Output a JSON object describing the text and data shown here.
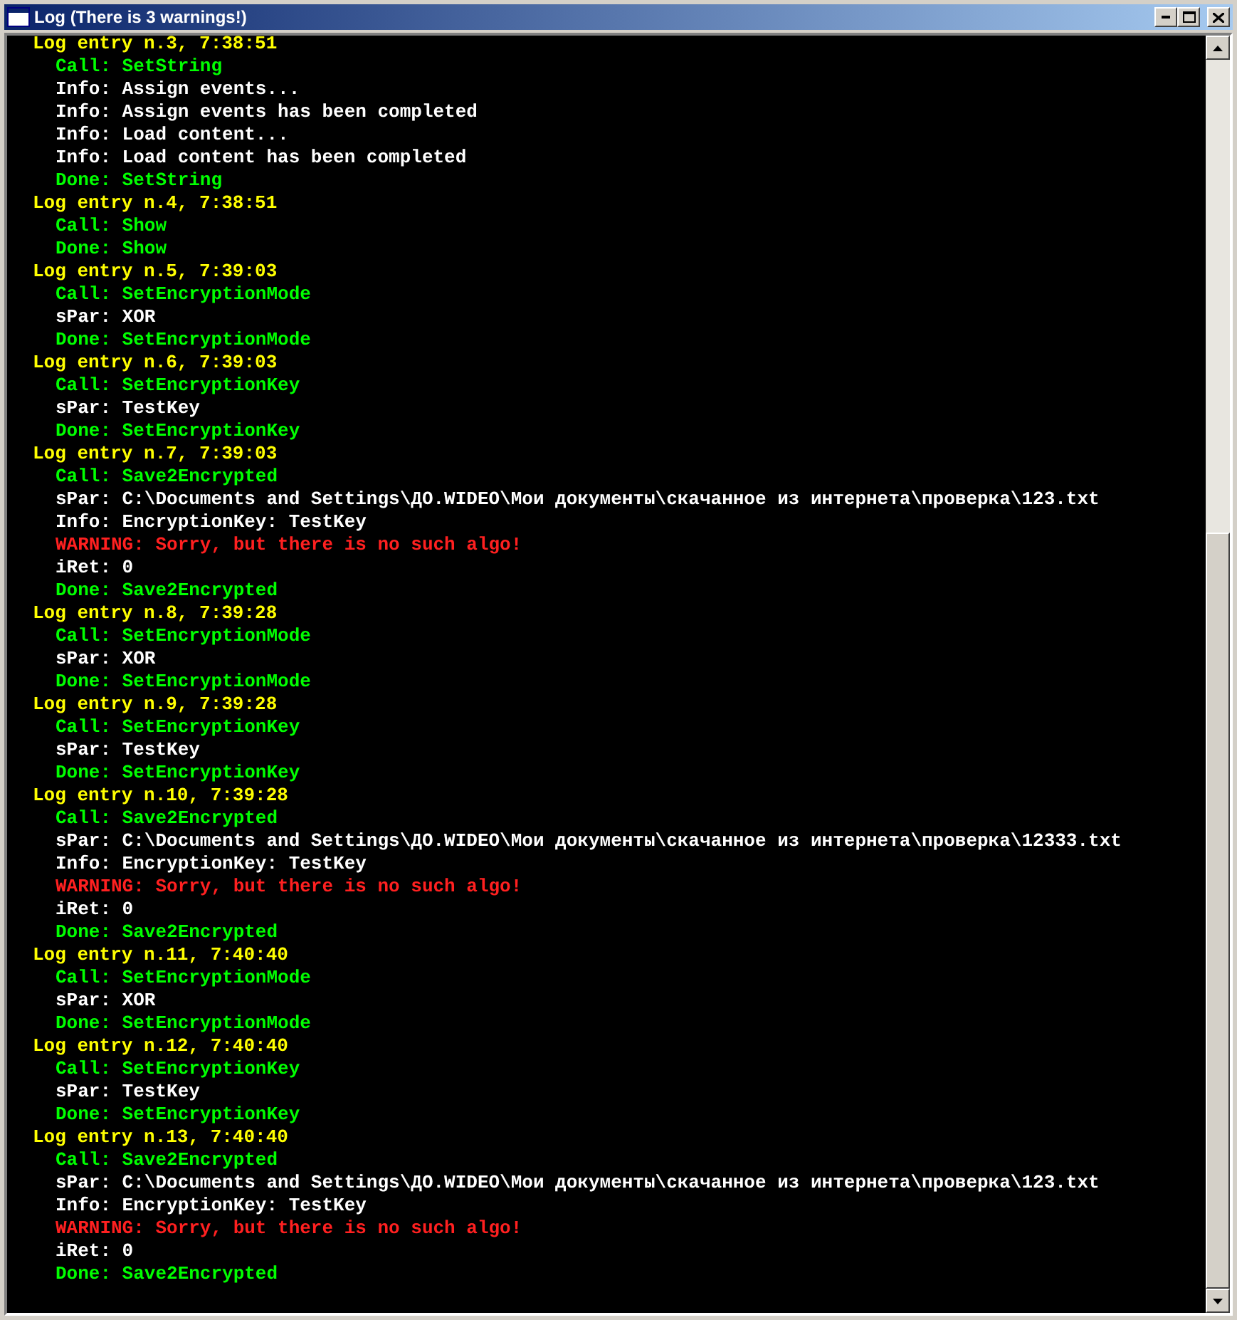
{
  "window": {
    "title": "Log (There is 3 warnings!)"
  },
  "lines": [
    {
      "kind": "header",
      "text": "Log entry n.3, 7:38:51"
    },
    {
      "kind": "call",
      "text": "Call: SetString"
    },
    {
      "kind": "info",
      "text": "Info: Assign events..."
    },
    {
      "kind": "info",
      "text": "Info: Assign events has been completed"
    },
    {
      "kind": "info",
      "text": "Info: Load content..."
    },
    {
      "kind": "info",
      "text": "Info: Load content has been completed"
    },
    {
      "kind": "call",
      "text": "Done: SetString"
    },
    {
      "kind": "header",
      "text": "Log entry n.4, 7:38:51"
    },
    {
      "kind": "call",
      "text": "Call: Show"
    },
    {
      "kind": "call",
      "text": "Done: Show"
    },
    {
      "kind": "header",
      "text": "Log entry n.5, 7:39:03"
    },
    {
      "kind": "call",
      "text": "Call: SetEncryptionMode"
    },
    {
      "kind": "info",
      "text": "sPar: XOR"
    },
    {
      "kind": "call",
      "text": "Done: SetEncryptionMode"
    },
    {
      "kind": "header",
      "text": "Log entry n.6, 7:39:03"
    },
    {
      "kind": "call",
      "text": "Call: SetEncryptionKey"
    },
    {
      "kind": "info",
      "text": "sPar: TestKey"
    },
    {
      "kind": "call",
      "text": "Done: SetEncryptionKey"
    },
    {
      "kind": "header",
      "text": "Log entry n.7, 7:39:03"
    },
    {
      "kind": "call",
      "text": "Call: Save2Encrypted"
    },
    {
      "kind": "info",
      "text": "sPar: C:\\Documents and Settings\\ДО.WIDEO\\Мои документы\\скачанное из интернета\\проверка\\123.txt"
    },
    {
      "kind": "info",
      "text": "Info: EncryptionKey: TestKey"
    },
    {
      "kind": "warning",
      "text": "WARNING: Sorry, but there is no such algo!"
    },
    {
      "kind": "info",
      "text": "iRet: 0"
    },
    {
      "kind": "call",
      "text": "Done: Save2Encrypted"
    },
    {
      "kind": "header",
      "text": "Log entry n.8, 7:39:28"
    },
    {
      "kind": "call",
      "text": "Call: SetEncryptionMode"
    },
    {
      "kind": "info",
      "text": "sPar: XOR"
    },
    {
      "kind": "call",
      "text": "Done: SetEncryptionMode"
    },
    {
      "kind": "header",
      "text": "Log entry n.9, 7:39:28"
    },
    {
      "kind": "call",
      "text": "Call: SetEncryptionKey"
    },
    {
      "kind": "info",
      "text": "sPar: TestKey"
    },
    {
      "kind": "call",
      "text": "Done: SetEncryptionKey"
    },
    {
      "kind": "header",
      "text": "Log entry n.10, 7:39:28"
    },
    {
      "kind": "call",
      "text": "Call: Save2Encrypted"
    },
    {
      "kind": "info",
      "text": "sPar: C:\\Documents and Settings\\ДО.WIDEO\\Мои документы\\скачанное из интернета\\проверка\\12333.txt"
    },
    {
      "kind": "info",
      "text": "Info: EncryptionKey: TestKey"
    },
    {
      "kind": "warning",
      "text": "WARNING: Sorry, but there is no such algo!"
    },
    {
      "kind": "info",
      "text": "iRet: 0"
    },
    {
      "kind": "call",
      "text": "Done: Save2Encrypted"
    },
    {
      "kind": "header",
      "text": "Log entry n.11, 7:40:40"
    },
    {
      "kind": "call",
      "text": "Call: SetEncryptionMode"
    },
    {
      "kind": "info",
      "text": "sPar: XOR"
    },
    {
      "kind": "call",
      "text": "Done: SetEncryptionMode"
    },
    {
      "kind": "header",
      "text": "Log entry n.12, 7:40:40"
    },
    {
      "kind": "call",
      "text": "Call: SetEncryptionKey"
    },
    {
      "kind": "info",
      "text": "sPar: TestKey"
    },
    {
      "kind": "call",
      "text": "Done: SetEncryptionKey"
    },
    {
      "kind": "header",
      "text": "Log entry n.13, 7:40:40"
    },
    {
      "kind": "call",
      "text": "Call: Save2Encrypted"
    },
    {
      "kind": "info",
      "text": "sPar: C:\\Documents and Settings\\ДО.WIDEO\\Мои документы\\скачанное из интернета\\проверка\\123.txt"
    },
    {
      "kind": "info",
      "text": "Info: EncryptionKey: TestKey"
    },
    {
      "kind": "warning",
      "text": "WARNING: Sorry, but there is no such algo!"
    },
    {
      "kind": "info",
      "text": "iRet: 0"
    },
    {
      "kind": "call",
      "text": "Done: Save2Encrypted"
    }
  ]
}
